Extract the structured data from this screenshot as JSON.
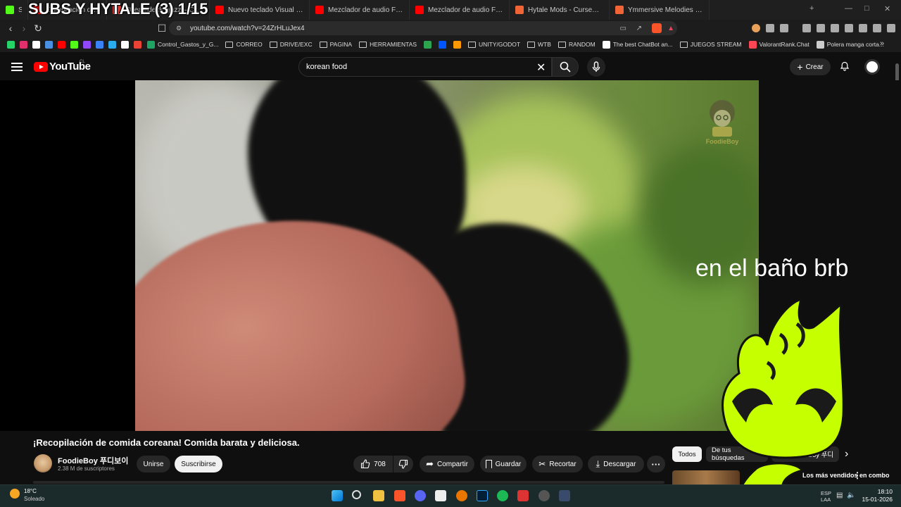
{
  "stream_overlay": {
    "title": "SUBS Y HYTALE (3) 1/15",
    "status_text": "en el baño brb"
  },
  "browser": {
    "tabs": [
      {
        "label": "S",
        "color": "#53fc18"
      },
      {
        "label": "Compilación de comida",
        "color": "#ff0000"
      },
      {
        "label": "Streamdeck ajazz – Compra st",
        "color": "#e53935"
      },
      {
        "label": "Nuevo teclado Visual Mirabox",
        "color": "#ff0000"
      },
      {
        "label": "Mezclador de audio FIFINE SC",
        "color": "#ff0000"
      },
      {
        "label": "Mezclador de audio FIFINE SC",
        "color": "#ff0000"
      },
      {
        "label": "Hytale Mods - CurseForge",
        "color": "#f16436"
      },
      {
        "label": "Ymmersive Melodies - Hytale",
        "color": "#f16436"
      }
    ],
    "new_tab": "+",
    "url": "youtube.com/watch?v=24ZrHLuJex4",
    "bookmarks": [
      {
        "label": "Control_Gastos_y_G...",
        "type": "icon",
        "color": "#1fa463"
      },
      {
        "label": "CORREO",
        "type": "folder"
      },
      {
        "label": "DRIVE/EXC",
        "type": "folder"
      },
      {
        "label": "PAGINA",
        "type": "folder"
      },
      {
        "label": "HERRAMIENTAS",
        "type": "folder"
      },
      {
        "label": "",
        "type": "icon",
        "color": "#2ea44f"
      },
      {
        "label": "",
        "type": "icon",
        "color": "#0057ff"
      },
      {
        "label": "",
        "type": "icon",
        "color": "#ff9900"
      },
      {
        "label": "UNITY/GODOT",
        "type": "folder"
      },
      {
        "label": "WTB",
        "type": "folder"
      },
      {
        "label": "RANDOM",
        "type": "folder"
      },
      {
        "label": "The best ChatBot an...",
        "type": "icon",
        "color": "#ffffff"
      },
      {
        "label": "JUEGOS STREAM",
        "type": "folder"
      },
      {
        "label": "ValorantRank.Chat",
        "type": "icon",
        "color": "#ff4655"
      },
      {
        "label": "Polera manga corta...",
        "type": "icon",
        "color": "#cccccc"
      }
    ],
    "bookmark_icons": [
      {
        "name": "whatsapp-icon",
        "color": "#25d366"
      },
      {
        "name": "instagram-icon",
        "color": "#e1306c"
      },
      {
        "name": "x-icon",
        "color": "#ffffff"
      },
      {
        "name": "folder-icon",
        "color": "#4a90e2"
      },
      {
        "name": "youtube-icon",
        "color": "#ff0000"
      },
      {
        "name": "kick-icon",
        "color": "#53fc18"
      },
      {
        "name": "twitch-icon",
        "color": "#9146ff"
      },
      {
        "name": "pencil-icon",
        "color": "#3b82f6"
      },
      {
        "name": "telegram-icon",
        "color": "#2aabee"
      },
      {
        "name": "tiktok-icon",
        "color": "#ffffff"
      },
      {
        "name": "gmail-icon",
        "color": "#ea4335"
      }
    ]
  },
  "youtube": {
    "logo_text": "YouTube",
    "country": "CL",
    "search_value": "korean food",
    "create_label": "Crear",
    "video": {
      "title": "¡Recopilación de comida coreana! Comida barata y deliciosa.",
      "channel": "FoodieBoy 푸디보이",
      "subscribers": "2.38 M de suscriptores",
      "join_label": "Unirse",
      "subscribe_label": "Suscribirse",
      "likes": "708",
      "share_label": "Compartir",
      "save_label": "Guardar",
      "clip_label": "Recortar",
      "download_label": "Descargar",
      "watermark": "FoodieBoy"
    },
    "chips": [
      "Todos",
      "De tus búsquedas",
      "De FoodieBoy 푸디"
    ],
    "related_title": "Los más vendidos en combo"
  },
  "taskbar": {
    "temperature": "18°C",
    "weather": "Soleado",
    "time": "18:10",
    "date": "15-01-2026",
    "lang": "ESP",
    "lang2": "LAA"
  }
}
